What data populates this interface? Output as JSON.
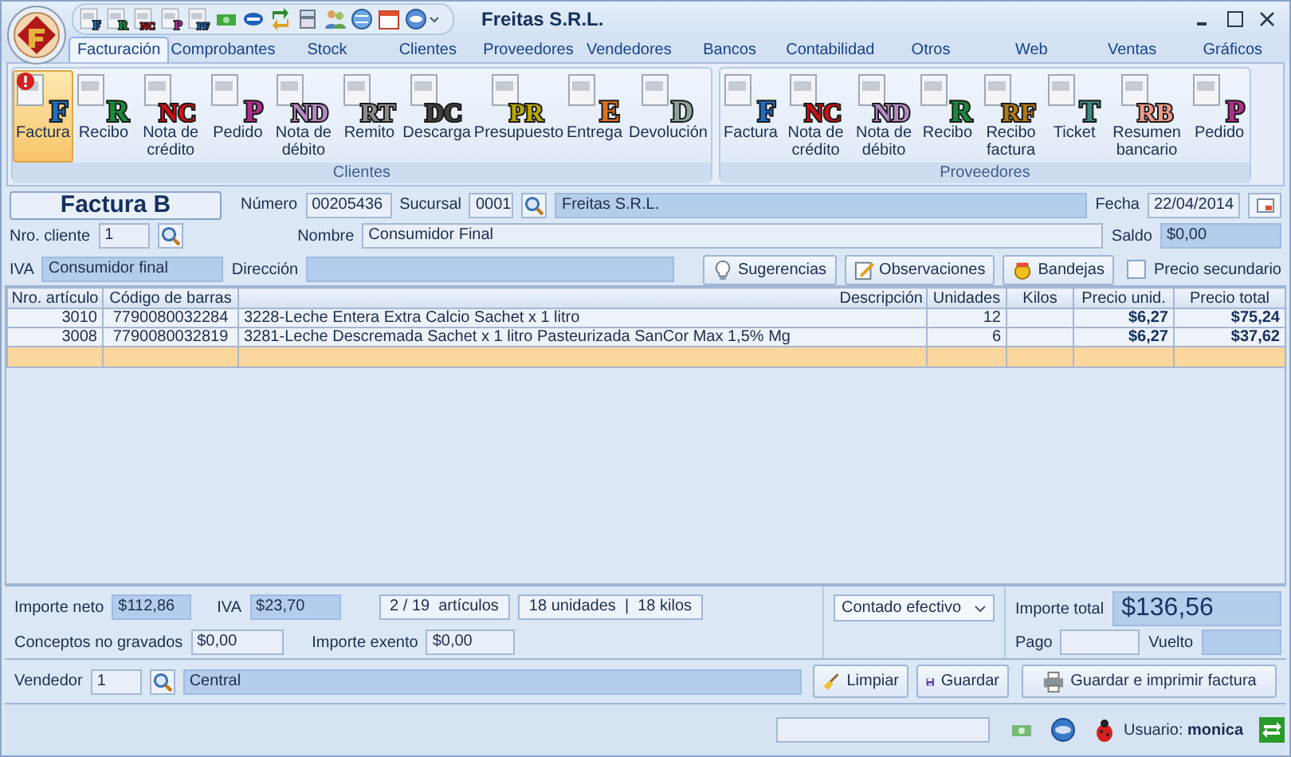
{
  "window": {
    "title": "Freitas S.R.L."
  },
  "quick_access": [
    {
      "icon_text": "F",
      "color": "#1d6fc4"
    },
    {
      "icon_text": "R",
      "color": "#1a8a3a"
    },
    {
      "icon_text": "NC",
      "color": "#d01010"
    },
    {
      "icon_text": "P",
      "color": "#b0308a"
    },
    {
      "icon_text": "PF",
      "color": "#1d6fc4"
    }
  ],
  "tabs": [
    {
      "label": "Facturación",
      "selected": true
    },
    {
      "label": "Comprobantes",
      "selected": false
    },
    {
      "label": "Stock",
      "selected": false
    },
    {
      "label": "Clientes",
      "selected": false
    },
    {
      "label": "Proveedores",
      "selected": false
    },
    {
      "label": "Vendedores",
      "selected": false
    },
    {
      "label": "Bancos",
      "selected": false
    },
    {
      "label": "Contabilidad",
      "selected": false
    },
    {
      "label": "Otros",
      "selected": false
    },
    {
      "label": "Web",
      "selected": false
    },
    {
      "label": "Ventas",
      "selected": false
    },
    {
      "label": "Gráficos",
      "selected": false
    }
  ],
  "ribbon": {
    "groups": [
      {
        "caption": "Clientes",
        "buttons": [
          {
            "label": "Factura",
            "icon_text": "F",
            "color": "#1d6fc4",
            "selected": true,
            "alert": true
          },
          {
            "label": "Recibo",
            "icon_text": "R",
            "color": "#1a8a3a",
            "selected": false,
            "alert": false
          },
          {
            "label": "Nota de crédito",
            "icon_text": "NC",
            "color": "#d01010",
            "selected": false,
            "alert": false
          },
          {
            "label": "Pedido",
            "icon_text": "P",
            "color": "#b0308a",
            "selected": false,
            "alert": false
          },
          {
            "label": "Nota de débito",
            "icon_text": "ND",
            "color": "#b48ac4",
            "selected": false,
            "alert": false
          },
          {
            "label": "Remito",
            "icon_text": "RT",
            "color": "#8c8c8c",
            "selected": false,
            "alert": false
          },
          {
            "label": "Descarga",
            "icon_text": "DC",
            "color": "#404040",
            "selected": false,
            "alert": false
          },
          {
            "label": "Presupuesto",
            "icon_text": "PR",
            "color": "#b8a800",
            "selected": false,
            "alert": false
          },
          {
            "label": "Entrega",
            "icon_text": "E",
            "color": "#e0701a",
            "selected": false,
            "alert": false
          },
          {
            "label": "Devolución",
            "icon_text": "D",
            "color": "#8aa49c",
            "selected": false,
            "alert": false
          }
        ]
      },
      {
        "caption": "Proveedores",
        "buttons": [
          {
            "label": "Factura",
            "icon_text": "F",
            "color": "#1d6fc4",
            "selected": false,
            "alert": false
          },
          {
            "label": "Nota de crédito",
            "icon_text": "NC",
            "color": "#d01010",
            "selected": false,
            "alert": false
          },
          {
            "label": "Nota de débito",
            "icon_text": "ND",
            "color": "#b48ac4",
            "selected": false,
            "alert": false
          },
          {
            "label": "Recibo",
            "icon_text": "R",
            "color": "#1a8a3a",
            "selected": false,
            "alert": false
          },
          {
            "label": "Recibo factura",
            "icon_text": "RF",
            "color": "#b07a10",
            "selected": false,
            "alert": false
          },
          {
            "label": "Ticket",
            "icon_text": "T",
            "color": "#3c8a80",
            "selected": false,
            "alert": false
          },
          {
            "label": "Resumen bancario",
            "icon_text": "RB",
            "color": "#f09a8a",
            "selected": false,
            "alert": false
          },
          {
            "label": "Pedido",
            "icon_text": "P",
            "color": "#b0308a",
            "selected": false,
            "alert": false
          }
        ]
      }
    ]
  },
  "form": {
    "title": "Factura B",
    "numero": {
      "label": "Número",
      "value": "00205436",
      "readonly": false
    },
    "sucursal": {
      "label": "Sucursal",
      "value": "0001",
      "readonly": false
    },
    "empresa": {
      "value": "Freitas S.R.L.",
      "readonly": true
    },
    "fecha": {
      "label": "Fecha",
      "value": "22/04/2014",
      "readonly": false
    },
    "nro_cliente": {
      "label": "Nro. cliente",
      "value": "1",
      "readonly": false
    },
    "nombre": {
      "label": "Nombre",
      "value": "Consumidor Final",
      "readonly": false
    },
    "saldo": {
      "label": "Saldo",
      "value": "$0,00",
      "readonly": true
    },
    "iva": {
      "label": "IVA",
      "value": "Consumidor final",
      "readonly": true
    },
    "direccion": {
      "label": "Dirección",
      "readonly": true
    },
    "actions": [
      {
        "label": "Sugerencias",
        "kind": "bulb"
      },
      {
        "label": "Observaciones",
        "kind": "note"
      },
      {
        "label": "Bandejas",
        "kind": "tray"
      }
    ],
    "precio_secundario": {
      "label": "Precio secundario",
      "checked": false
    }
  },
  "table": {
    "columns": [
      "Nro. artículo",
      "Código de barras",
      "Descripción",
      "Unidades",
      "Kilos",
      "Precio unid.",
      "Precio total"
    ],
    "rows": [
      {
        "cells": [
          "3010",
          "7790080032284",
          "3228-Leche Entera Extra Calcio Sachet x 1 litro",
          "12",
          "",
          "$6,27",
          "$75,24"
        ],
        "selected": false
      },
      {
        "cells": [
          "3008",
          "7790080032819",
          "3281-Leche Descremada Sachet x 1 litro Pasteurizada SanCor Max 1,5% Mg",
          "6",
          "",
          "$6,27",
          "$37,62"
        ],
        "selected": false
      }
    ],
    "entry_row": {
      "selected": true
    }
  },
  "totals": {
    "importe_neto": {
      "label": "Importe neto",
      "value": "$112,86",
      "readonly": true
    },
    "iva": {
      "label": "IVA",
      "value": "$23,70",
      "readonly": true
    },
    "articulos": "2 / 19  artículos",
    "unidades_kilos": "18 unidades  |  18 kilos",
    "conceptos_no_gravados": {
      "label": "Conceptos no gravados",
      "value": "$0,00",
      "readonly": false
    },
    "importe_exento": {
      "label": "Importe exento",
      "value": "$0,00",
      "readonly": false
    },
    "forma_pago": "Contado efectivo",
    "importe_total": {
      "label": "Importe total",
      "value": "$136,56"
    },
    "pago": {
      "label": "Pago",
      "readonly": false
    },
    "vuelto": {
      "label": "Vuelto",
      "readonly": true
    }
  },
  "vendedor": {
    "label": "Vendedor",
    "code": "1",
    "name": "Central"
  },
  "buttons": [
    {
      "label": "Limpiar",
      "kind": "broom"
    },
    {
      "label": "Guardar",
      "kind": "save"
    },
    {
      "label": "Guardar e imprimir factura",
      "kind": "print"
    }
  ],
  "status_bar": {
    "user": "Usuario: **monica**"
  }
}
